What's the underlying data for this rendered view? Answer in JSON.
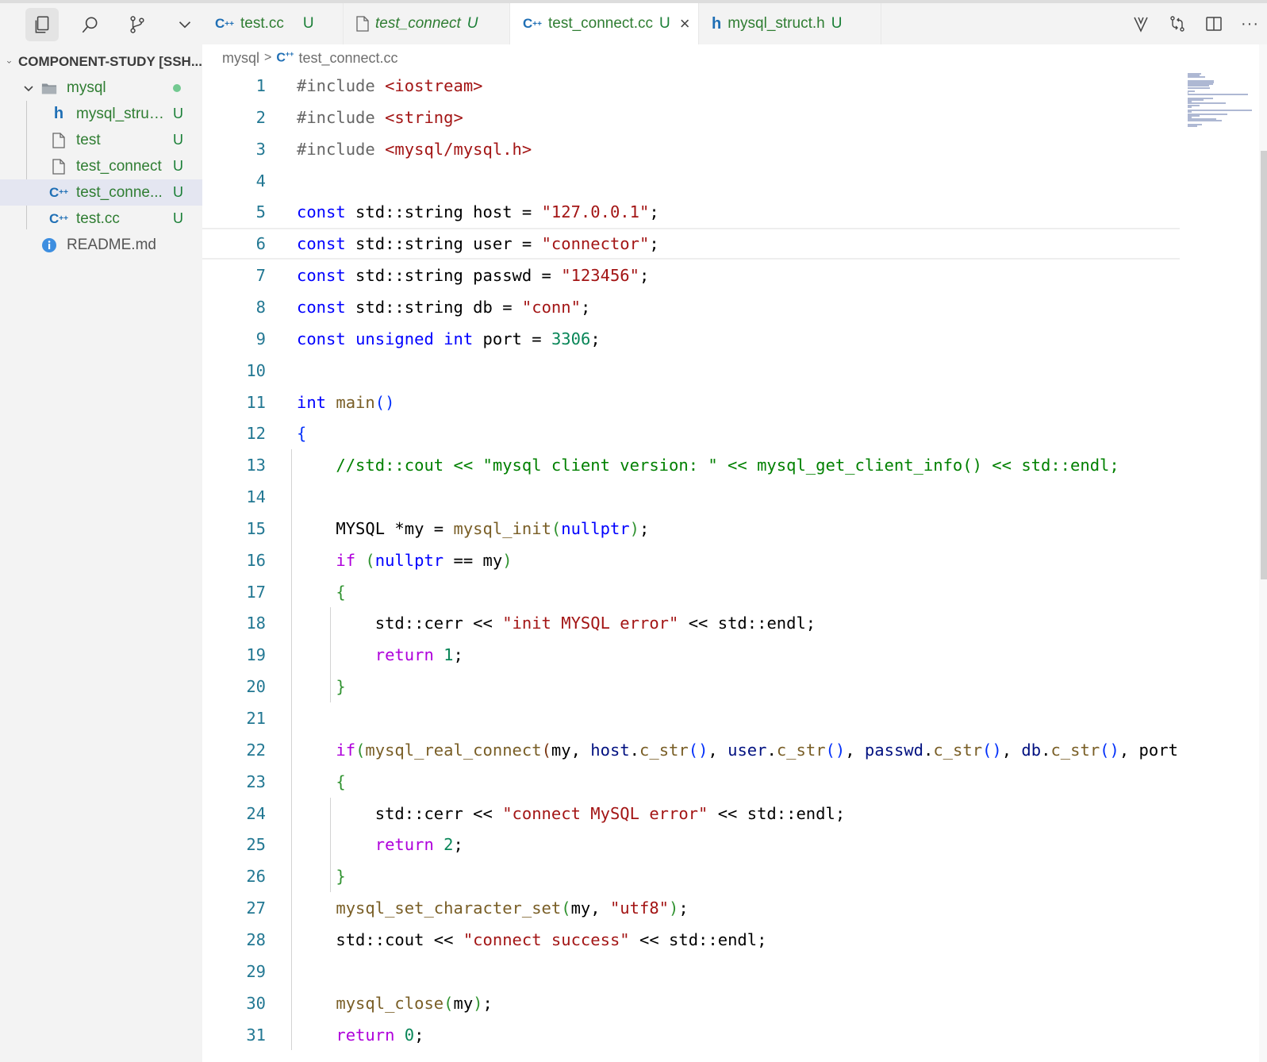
{
  "explorer": {
    "header": "COMPONENT-STUDY [SSH...",
    "tree": [
      {
        "label": "mysql",
        "icon": "folder-icon",
        "status": "modified-dot",
        "level": 1
      },
      {
        "label": "mysql_struc...",
        "icon": "c-header-icon",
        "badge": "U",
        "level": 2
      },
      {
        "label": "test",
        "icon": "file-icon",
        "badge": "U",
        "level": 2
      },
      {
        "label": "test_connect",
        "icon": "file-icon",
        "badge": "U",
        "level": 2
      },
      {
        "label": "test_conne...",
        "icon": "cpp-icon",
        "badge": "U",
        "level": 2,
        "selected": true
      },
      {
        "label": "test.cc",
        "icon": "cpp-icon",
        "badge": "U",
        "level": 2
      },
      {
        "label": "README.md",
        "icon": "info-icon",
        "level": 1
      }
    ]
  },
  "tabs": [
    {
      "label": "test.cc",
      "badge": "U",
      "icon": "cpp-icon"
    },
    {
      "label": "test_connect",
      "badge": "U",
      "icon": "file-icon",
      "italic": true
    },
    {
      "label": "test_connect.cc",
      "badge": "U",
      "icon": "cpp-icon",
      "active": true,
      "close": "×"
    },
    {
      "label": "mysql_struct.h",
      "badge": "U",
      "icon": "c-header-icon"
    }
  ],
  "tab_actions": {
    "more": "···"
  },
  "breadcrumb": {
    "folder": "mysql",
    "separator": ">",
    "file": "test_connect.cc"
  },
  "editor": {
    "line_numbers": [
      "1",
      "2",
      "3",
      "4",
      "5",
      "6",
      "7",
      "8",
      "9",
      "10",
      "11",
      "12",
      "13",
      "14",
      "15",
      "16",
      "17",
      "18",
      "19",
      "20",
      "21",
      "22",
      "23",
      "24",
      "25",
      "26",
      "27",
      "28",
      "29",
      "30",
      "31"
    ],
    "lines": [
      [
        [
          "pp",
          "#include "
        ],
        [
          "hdr",
          "<iostream>"
        ]
      ],
      [
        [
          "pp",
          "#include "
        ],
        [
          "hdr",
          "<string>"
        ]
      ],
      [
        [
          "pp",
          "#include "
        ],
        [
          "hdr",
          "<mysql/mysql.h>"
        ]
      ],
      [],
      [
        [
          "kw",
          "const"
        ],
        [
          "pl",
          " std::string host = "
        ],
        [
          "str",
          "\"127.0.0.1\""
        ],
        [
          "pl",
          ";"
        ]
      ],
      [
        [
          "kw",
          "const"
        ],
        [
          "pl",
          " std::string user = "
        ],
        [
          "str",
          "\"connector\""
        ],
        [
          "pl",
          ";"
        ]
      ],
      [
        [
          "kw",
          "const"
        ],
        [
          "pl",
          " std::string passwd = "
        ],
        [
          "str",
          "\"123456\""
        ],
        [
          "pl",
          ";"
        ]
      ],
      [
        [
          "kw",
          "const"
        ],
        [
          "pl",
          " std::string db = "
        ],
        [
          "str",
          "\"conn\""
        ],
        [
          "pl",
          ";"
        ]
      ],
      [
        [
          "kw",
          "const"
        ],
        [
          "pl",
          " "
        ],
        [
          "kw",
          "unsigned"
        ],
        [
          "pl",
          " "
        ],
        [
          "kw",
          "int"
        ],
        [
          "pl",
          " port = "
        ],
        [
          "num",
          "3306"
        ],
        [
          "pl",
          ";"
        ]
      ],
      [],
      [
        [
          "kw",
          "int"
        ],
        [
          "pl",
          " "
        ],
        [
          "fn",
          "main"
        ],
        [
          "br1",
          "()"
        ]
      ],
      [
        [
          "br1",
          "{"
        ]
      ],
      [
        [
          "pl",
          "    "
        ],
        [
          "cm",
          "//std::cout << \"mysql client version: \" << mysql_get_client_info() << std::endl;"
        ]
      ],
      [],
      [
        [
          "pl",
          "    MYSQL *my = "
        ],
        [
          "fn",
          "mysql_init"
        ],
        [
          "br2",
          "("
        ],
        [
          "kw",
          "nullptr"
        ],
        [
          "br2",
          ")"
        ],
        [
          "pl",
          ";"
        ]
      ],
      [
        [
          "pl",
          "    "
        ],
        [
          "ctl",
          "if"
        ],
        [
          "pl",
          " "
        ],
        [
          "br2",
          "("
        ],
        [
          "kw",
          "nullptr"
        ],
        [
          "pl",
          " == my"
        ],
        [
          "br2",
          ")"
        ]
      ],
      [
        [
          "pl",
          "    "
        ],
        [
          "br2",
          "{"
        ]
      ],
      [
        [
          "pl",
          "        std::cerr << "
        ],
        [
          "str",
          "\"init MYSQL error\""
        ],
        [
          "pl",
          " << std::endl;"
        ]
      ],
      [
        [
          "pl",
          "        "
        ],
        [
          "ctl",
          "return"
        ],
        [
          "pl",
          " "
        ],
        [
          "num",
          "1"
        ],
        [
          "pl",
          ";"
        ]
      ],
      [
        [
          "pl",
          "    "
        ],
        [
          "br2",
          "}"
        ]
      ],
      [],
      [
        [
          "pl",
          "    "
        ],
        [
          "ctl",
          "if"
        ],
        [
          "br2",
          "("
        ],
        [
          "fn",
          "mysql_real_connect"
        ],
        [
          "br3",
          "("
        ],
        [
          "pl",
          "my, "
        ],
        [
          "var",
          "host"
        ],
        [
          "pl",
          "."
        ],
        [
          "fn",
          "c_str"
        ],
        [
          "br1",
          "()"
        ],
        [
          "pl",
          ", "
        ],
        [
          "var",
          "user"
        ],
        [
          "pl",
          "."
        ],
        [
          "fn",
          "c_str"
        ],
        [
          "br1",
          "()"
        ],
        [
          "pl",
          ", "
        ],
        [
          "var",
          "passwd"
        ],
        [
          "pl",
          "."
        ],
        [
          "fn",
          "c_str"
        ],
        [
          "br1",
          "()"
        ],
        [
          "pl",
          ", "
        ],
        [
          "var",
          "db"
        ],
        [
          "pl",
          "."
        ],
        [
          "fn",
          "c_str"
        ],
        [
          "br1",
          "()"
        ],
        [
          "pl",
          ", port"
        ]
      ],
      [
        [
          "pl",
          "    "
        ],
        [
          "br2",
          "{"
        ]
      ],
      [
        [
          "pl",
          "        std::cerr << "
        ],
        [
          "str",
          "\"connect MySQL error\""
        ],
        [
          "pl",
          " << std::endl;"
        ]
      ],
      [
        [
          "pl",
          "        "
        ],
        [
          "ctl",
          "return"
        ],
        [
          "pl",
          " "
        ],
        [
          "num",
          "2"
        ],
        [
          "pl",
          ";"
        ]
      ],
      [
        [
          "pl",
          "    "
        ],
        [
          "br2",
          "}"
        ]
      ],
      [
        [
          "pl",
          "    "
        ],
        [
          "fn",
          "mysql_set_character_set"
        ],
        [
          "br2",
          "("
        ],
        [
          "pl",
          "my, "
        ],
        [
          "str",
          "\"utf8\""
        ],
        [
          "br2",
          ")"
        ],
        [
          "pl",
          ";"
        ]
      ],
      [
        [
          "pl",
          "    std::cout << "
        ],
        [
          "str",
          "\"connect success\""
        ],
        [
          "pl",
          " << std::endl;"
        ]
      ],
      [],
      [
        [
          "pl",
          "    "
        ],
        [
          "fn",
          "mysql_close"
        ],
        [
          "br2",
          "("
        ],
        [
          "pl",
          "my"
        ],
        [
          "br2",
          ")"
        ],
        [
          "pl",
          ";"
        ]
      ],
      [
        [
          "pl",
          "    "
        ],
        [
          "ctl",
          "return"
        ],
        [
          "pl",
          " "
        ],
        [
          "num",
          "0"
        ],
        [
          "pl",
          ";"
        ]
      ]
    ],
    "current_line": 6
  },
  "colors": {
    "keyword": "#0000ff",
    "control": "#af00db",
    "string": "#a31515",
    "number": "#098658",
    "function": "#795e26",
    "comment": "#008000",
    "line_number": "#237893",
    "git_untracked": "#1a7f37"
  }
}
